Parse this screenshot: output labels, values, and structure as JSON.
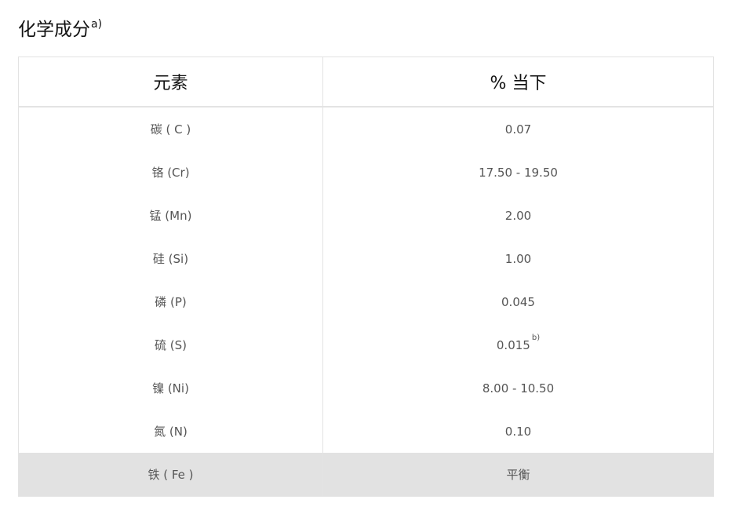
{
  "title": {
    "text": "化学成分",
    "footnote": "a)"
  },
  "table": {
    "headers": [
      "元素",
      "% 当下"
    ],
    "rows": [
      {
        "element": "碳 ( C )",
        "value": "0.07",
        "note": ""
      },
      {
        "element": "铬 (Cr)",
        "value": "17.50 - 19.50",
        "note": ""
      },
      {
        "element": "锰 (Mn)",
        "value": "2.00",
        "note": ""
      },
      {
        "element": "硅 (Si)",
        "value": "1.00",
        "note": ""
      },
      {
        "element": "磷 (P)",
        "value": "0.045",
        "note": ""
      },
      {
        "element": "硫 (S)",
        "value": "0.015",
        "note": "b)"
      },
      {
        "element": "镍 (Ni)",
        "value": "8.00 - 10.50",
        "note": ""
      },
      {
        "element": "氮 (N)",
        "value": "0.10",
        "note": ""
      },
      {
        "element": "铁 ( Fe )",
        "value": "平衡",
        "note": ""
      }
    ]
  },
  "colors": {
    "highlight_row": "#e2e2e2",
    "border": "#e3e3e3",
    "cell_text": "#555555"
  }
}
